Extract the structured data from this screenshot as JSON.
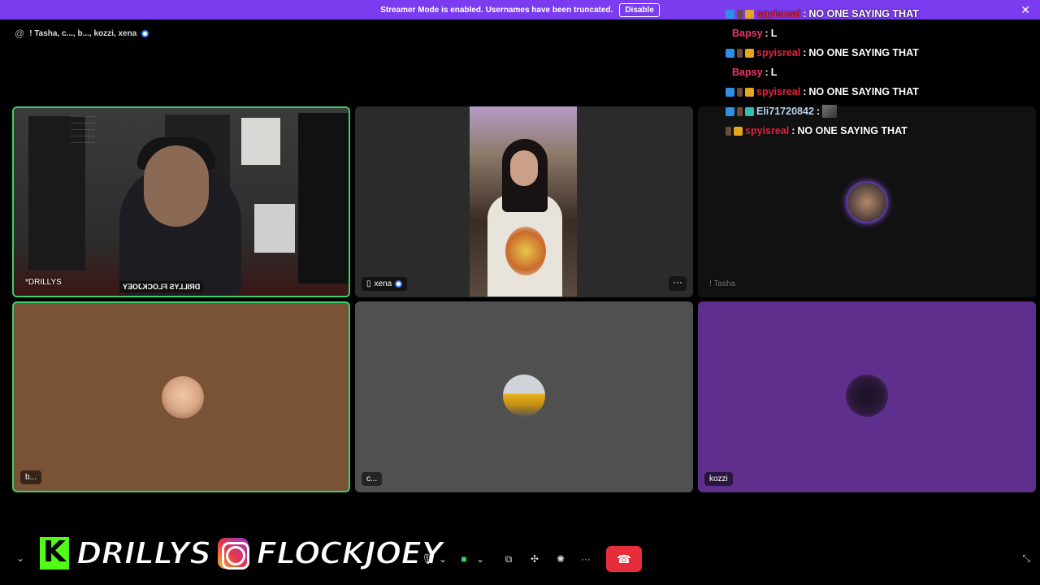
{
  "banner": {
    "text": "Streamer Mode is enabled. Usernames have been truncated.",
    "disable_label": "Disable",
    "close_glyph": "✕"
  },
  "channel": {
    "at_glyph": "@",
    "members": "! Tasha, c..., b..., kozzi, xena"
  },
  "tiles": [
    {
      "label": "*DRILLYS",
      "overlay": "DRILLYS  FLOCKJOEY"
    },
    {
      "label": "xena",
      "device_glyph": "▯"
    },
    {
      "label": "! Tasha"
    },
    {
      "label": "b...",
      "bg": "#7a5236"
    },
    {
      "label": "c...",
      "bg": "#4f504f"
    },
    {
      "label": "kozzi",
      "bg": "#5e2f8c"
    }
  ],
  "more_glyph": "···",
  "chat": [
    {
      "user": "spyisreal",
      "sep": " : ",
      "msg": "NO ONE SAYING THAT",
      "badges": [
        "blue",
        "grey",
        "gold"
      ],
      "style": "red"
    },
    {
      "user": "Bapsy",
      "sep": " : ",
      "msg": "L",
      "badges": [],
      "style": "pink"
    },
    {
      "user": "spyisreal",
      "sep": " : ",
      "msg": "NO ONE SAYING THAT",
      "badges": [
        "blue",
        "grey",
        "gold"
      ],
      "style": "red"
    },
    {
      "user": "Bapsy",
      "sep": " : ",
      "msg": "L",
      "badges": [],
      "style": "pink"
    },
    {
      "user": "spyisreal",
      "sep": " : ",
      "msg": "NO ONE SAYING THAT",
      "badges": [
        "blue",
        "grey",
        "gold"
      ],
      "style": "red"
    },
    {
      "user": "Eli71720842",
      "sep": " : ",
      "msg": "",
      "badges": [
        "blue",
        "grey",
        "teal"
      ],
      "style": "light",
      "emote": true
    },
    {
      "user": "spyisreal",
      "sep": " : ",
      "msg": "NO ONE SAYING THAT",
      "badges": [
        "grey",
        "gold"
      ],
      "style": "red"
    }
  ],
  "branding": {
    "kick_letter": "K",
    "name1": "DRILLYS",
    "name2": "FLOCKJOEY"
  },
  "controls": {
    "chevron_glyph": "⌄",
    "mic_glyph": "🎙",
    "dropdown_glyph": "⌄",
    "camera_glyph": "■",
    "screenshare_glyph": "⧉",
    "activities_glyph": "✣",
    "soundboard_glyph": "✺",
    "more_glyph": "···",
    "hangup_glyph": "☎",
    "fullscreen_glyph": "⤡"
  },
  "colors": {
    "banner": "#7b3cf0",
    "active_border": "#3ecf6a",
    "hangup": "#e52d3b"
  }
}
